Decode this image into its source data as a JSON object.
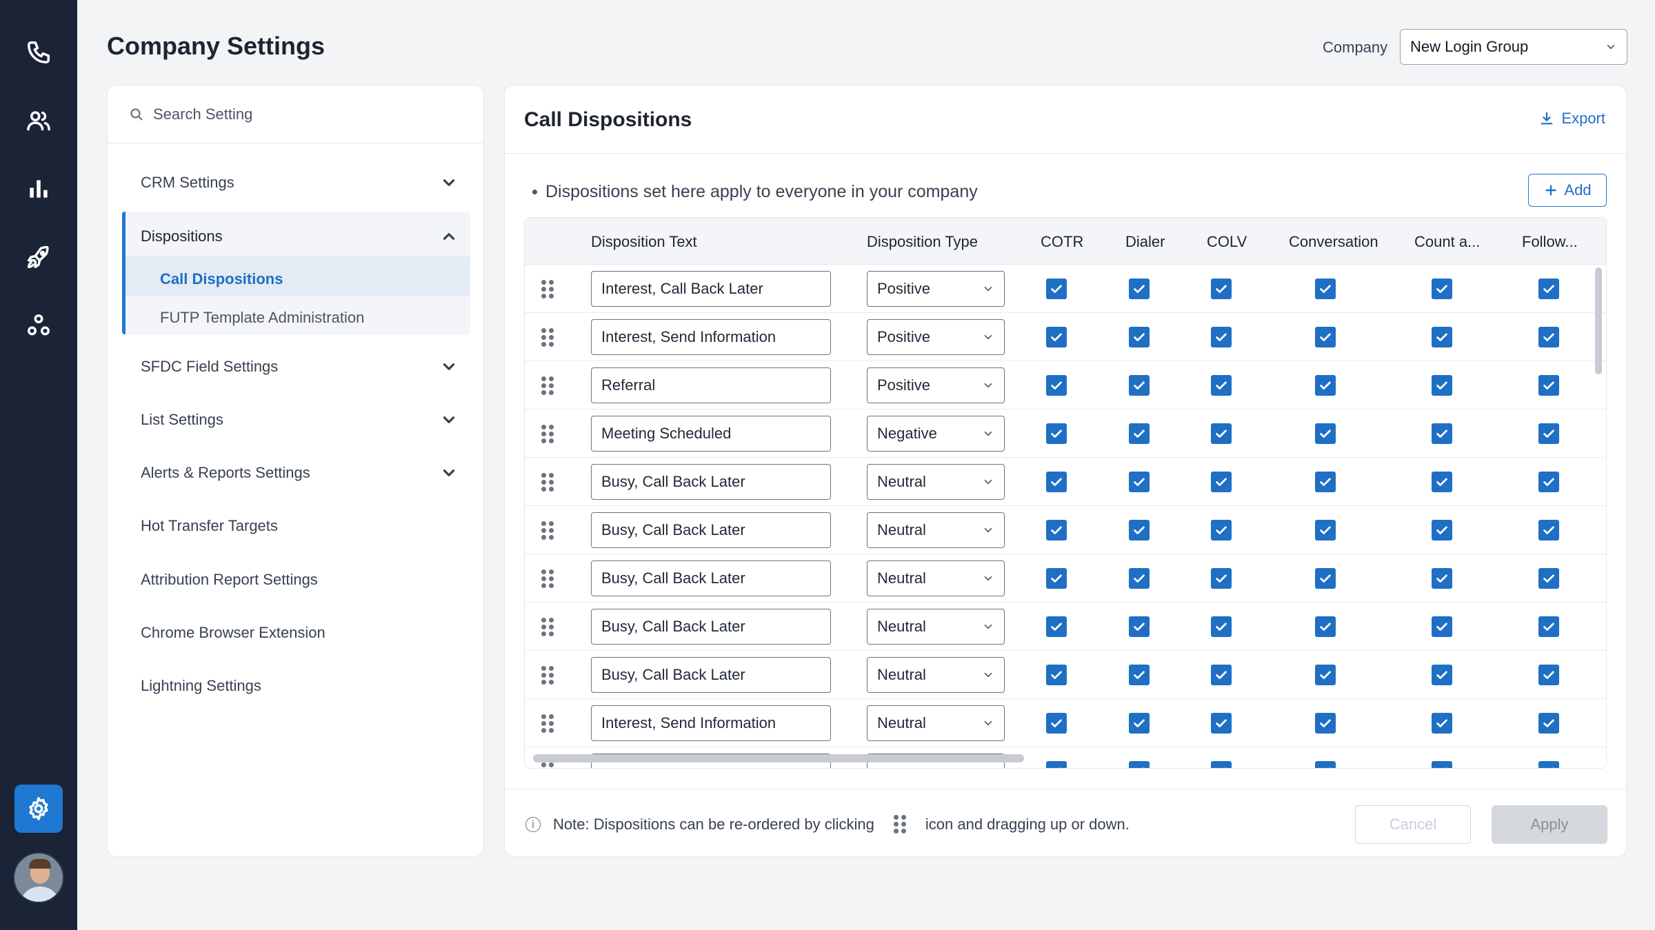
{
  "header": {
    "title": "Company Settings",
    "company_label": "Company",
    "company_value": "New Login Group"
  },
  "rail": {
    "items": [
      "phone-icon",
      "contacts-icon",
      "analytics-icon",
      "rocket-icon",
      "integrations-icon",
      "settings-icon"
    ],
    "active": "settings-icon"
  },
  "sidebar": {
    "search_placeholder": "Search Setting",
    "items": [
      {
        "label": "CRM Settings",
        "expandable": true,
        "expanded": false
      },
      {
        "label": "Dispositions",
        "expandable": true,
        "expanded": true,
        "children": [
          {
            "label": "Call Dispositions",
            "active": true
          },
          {
            "label": "FUTP Template Administration",
            "active": false
          }
        ]
      },
      {
        "label": "SFDC Field Settings",
        "expandable": true,
        "expanded": false
      },
      {
        "label": "List Settings",
        "expandable": true,
        "expanded": false
      },
      {
        "label": "Alerts & Reports Settings",
        "expandable": true,
        "expanded": false
      },
      {
        "label": "Hot Transfer Targets",
        "expandable": false
      },
      {
        "label": "Attribution Report Settings",
        "expandable": false
      },
      {
        "label": "Chrome Browser Extension",
        "expandable": false
      },
      {
        "label": "Lightning Settings",
        "expandable": false
      }
    ]
  },
  "main": {
    "title": "Call Dispositions",
    "export_label": "Export",
    "hint": "Dispositions set here apply to everyone in your company",
    "add_label": "Add",
    "columns": [
      "Disposition Text",
      "Disposition Type",
      "COTR",
      "Dialer",
      "COLV",
      "Conversation",
      "Count a...",
      "Follow..."
    ],
    "rows": [
      {
        "text": "Interest, Call Back Later",
        "type": "Positive",
        "checks": [
          true,
          true,
          true,
          true,
          true,
          true
        ]
      },
      {
        "text": "Interest, Send Information",
        "type": "Positive",
        "checks": [
          true,
          true,
          true,
          true,
          true,
          true
        ]
      },
      {
        "text": "Referral",
        "type": "Positive",
        "checks": [
          true,
          true,
          true,
          true,
          true,
          true
        ]
      },
      {
        "text": "Meeting Scheduled",
        "type": "Negative",
        "checks": [
          true,
          true,
          true,
          true,
          true,
          true
        ]
      },
      {
        "text": "Busy, Call Back Later",
        "type": "Neutral",
        "checks": [
          true,
          true,
          true,
          true,
          true,
          true
        ]
      },
      {
        "text": "Busy, Call Back Later",
        "type": "Neutral",
        "checks": [
          true,
          true,
          true,
          true,
          true,
          true
        ]
      },
      {
        "text": "Busy, Call Back Later",
        "type": "Neutral",
        "checks": [
          true,
          true,
          true,
          true,
          true,
          true
        ]
      },
      {
        "text": "Busy, Call Back Later",
        "type": "Neutral",
        "checks": [
          true,
          true,
          true,
          true,
          true,
          true
        ]
      },
      {
        "text": "Busy, Call Back Later",
        "type": "Neutral",
        "checks": [
          true,
          true,
          true,
          true,
          true,
          true
        ]
      },
      {
        "text": "Interest, Send Information",
        "type": "Neutral",
        "checks": [
          true,
          true,
          true,
          true,
          true,
          true
        ]
      }
    ],
    "note_before": "Note: Dispositions can be re-ordered by clicking",
    "note_after": "icon and dragging up or down.",
    "cancel_label": "Cancel",
    "apply_label": "Apply"
  },
  "colors": {
    "rail_bg": "#1b2337",
    "accent": "#1f78d1",
    "checkbox": "#1f6fc4"
  }
}
